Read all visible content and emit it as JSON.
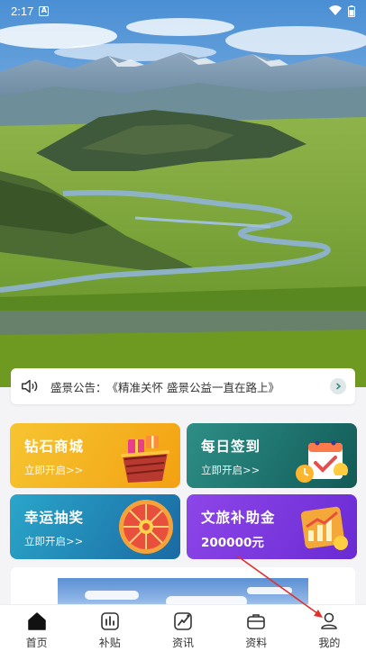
{
  "status_bar": {
    "time": "2:17",
    "notif_icon": "A"
  },
  "notice": {
    "label": "盛景公告：",
    "text": "《精准关怀 盛景公益一直在路上》"
  },
  "cards": [
    {
      "title": "钻石商城",
      "sub": "立即开启>>",
      "icon": "gift-basket-icon"
    },
    {
      "title": "每日签到",
      "sub": "立即开启>>",
      "icon": "calendar-icon"
    },
    {
      "title": "幸运抽奖",
      "sub": "立即开启>>",
      "icon": "prize-wheel-icon"
    },
    {
      "title": "文旅补助金",
      "sub": "200000元",
      "icon": "growth-chart-icon"
    }
  ],
  "tabs": [
    {
      "label": "首页",
      "icon": "home-icon"
    },
    {
      "label": "补贴",
      "icon": "bars-icon"
    },
    {
      "label": "资讯",
      "icon": "trend-icon"
    },
    {
      "label": "资料",
      "icon": "briefcase-icon"
    },
    {
      "label": "我的",
      "icon": "user-icon"
    }
  ],
  "colors": {
    "active_tab": "#111111",
    "accent_arrow": "#e0302a"
  }
}
